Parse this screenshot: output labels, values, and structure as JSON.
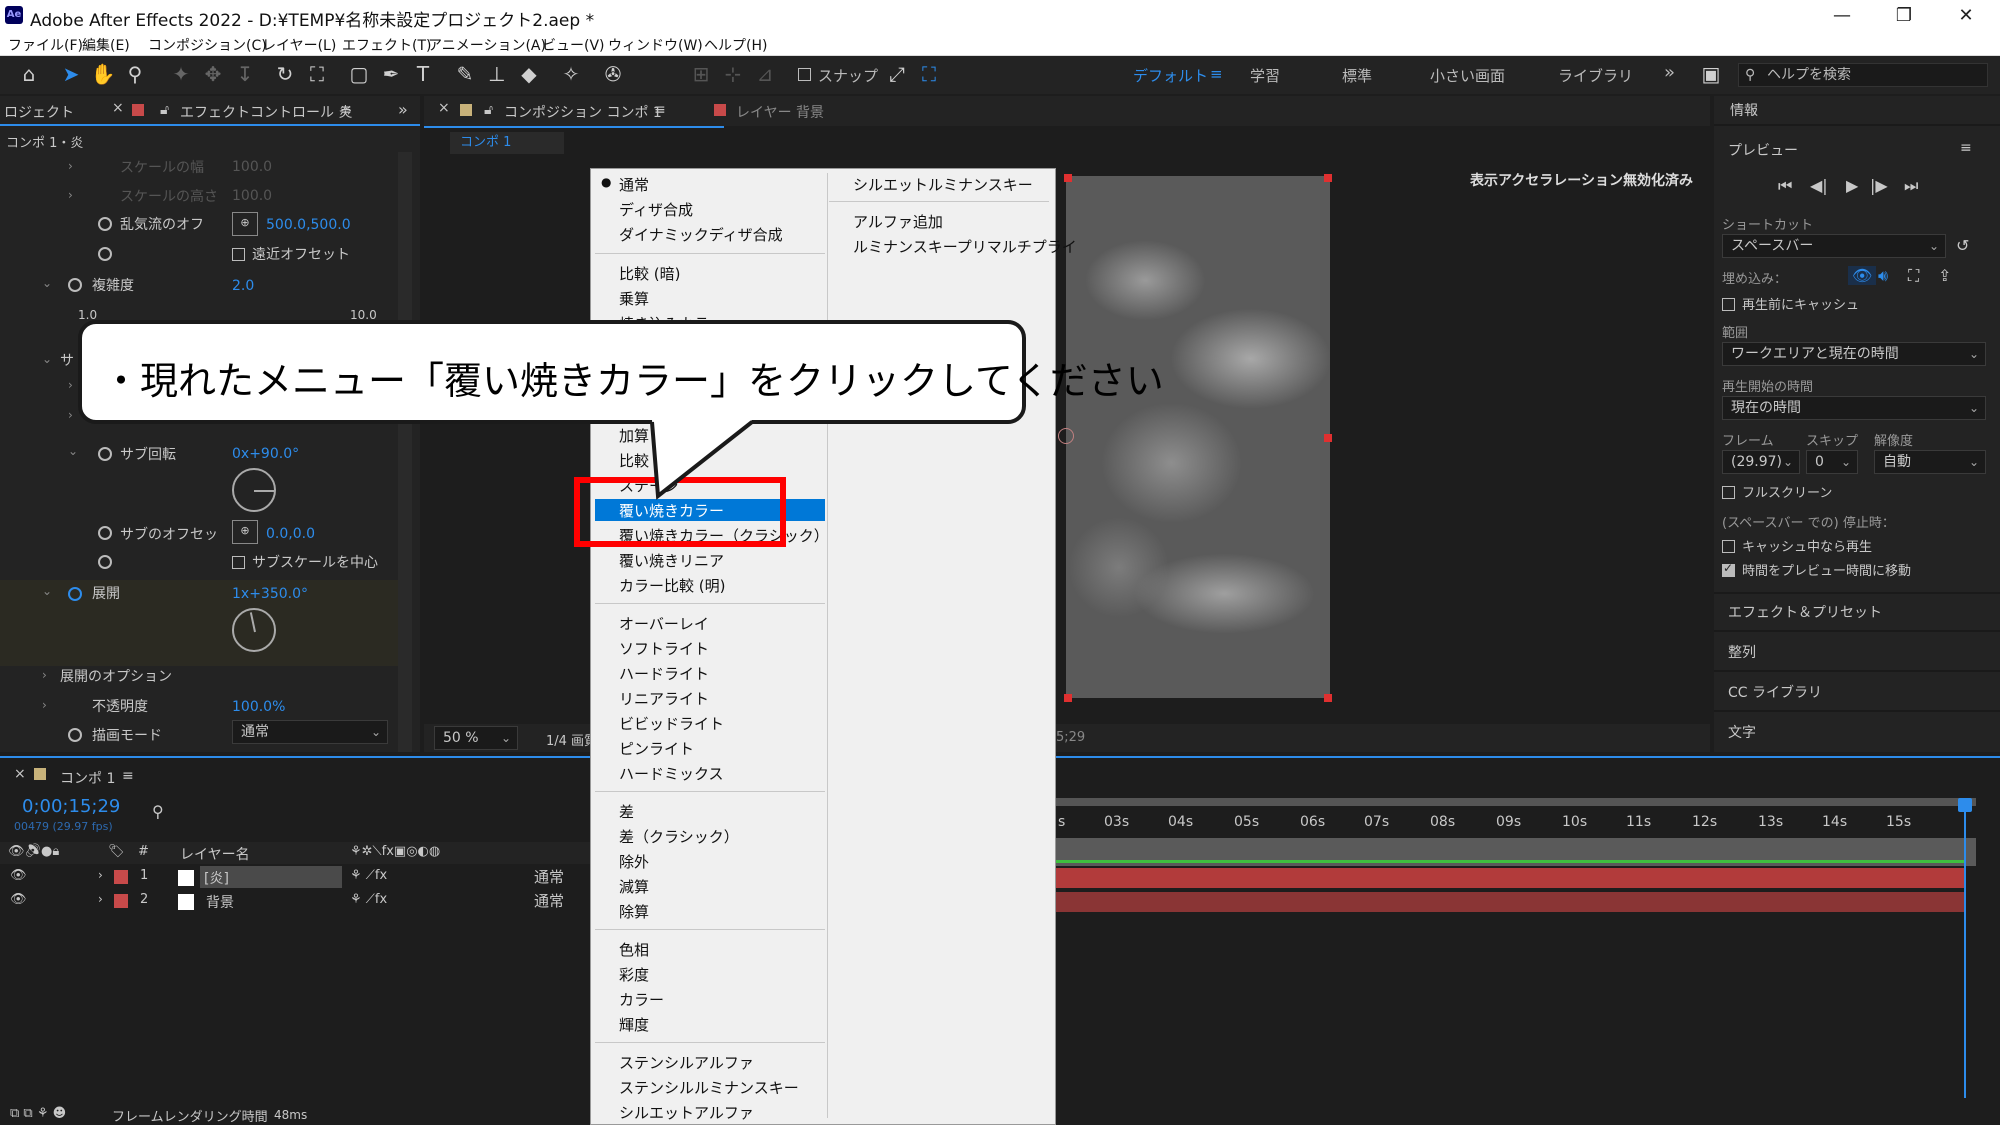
{
  "app": {
    "title": "Adobe After Effects 2022 - D:¥TEMP¥名称未設定プロジェクト2.aep *",
    "logo_text": "Ae",
    "window_controls": [
      "—",
      "❐",
      "✕"
    ]
  },
  "menubar": [
    "ファイル(F)",
    "編集(E)",
    "コンポジション(C)",
    "レイヤー(L)",
    "エフェクト(T)",
    "アニメーション(A)",
    "ビュー(V)",
    "ウィンドウ(W)",
    "ヘルプ(H)"
  ],
  "toolbar": {
    "snap_label": "スナップ",
    "workspaces": [
      "デフォルト",
      "学習",
      "標準",
      "小さい画面",
      "ライブラリ"
    ],
    "active_workspace": "デフォルト",
    "more": "»",
    "search_placeholder": "ヘルプを検索"
  },
  "left_panel": {
    "tab_project": "ロジェクト",
    "tab_effect_controls": "エフェクトコントロール 炎",
    "breadcrumb": "コンポ 1・炎",
    "props": [
      {
        "label": "スケールの幅",
        "value": "100.0"
      },
      {
        "label": "スケールの高さ",
        "value": "100.0"
      },
      {
        "label": "乱気流のオフ",
        "value": "500.0,500.0"
      },
      {
        "label": "遠近オフセット",
        "value": ""
      },
      {
        "label": "複雑度",
        "value": "2.0"
      },
      {
        "label": "1.0",
        "value": "10.0"
      },
      {
        "label": "サ",
        "value": ""
      },
      {
        "label": "サブ回転",
        "value": "0x+90.0°"
      },
      {
        "label": "サブのオフセッ",
        "value": "0.0,0.0"
      },
      {
        "label": "サブスケールを中心",
        "value": ""
      },
      {
        "label": "展開",
        "value": "1x+350.0°"
      },
      {
        "label": "展開のオプション",
        "value": ""
      },
      {
        "label": "不透明度",
        "value": "100.0%"
      },
      {
        "label": "描画モード",
        "value": "通常"
      }
    ]
  },
  "comp_panel": {
    "tab_composition": "コンポジション コンポ 1",
    "tab_layer": "レイヤー 背景",
    "comp_name": "コンポ 1",
    "acceleration_notice": "表示アクセラレーション無効化済み",
    "zoom": "50 %",
    "resolution": "1/4 画質",
    "timecode_fragment": "5;29"
  },
  "context_menu": {
    "col1_groups": [
      [
        "通常",
        "ディザ合成",
        "ダイナミックディザ合成"
      ],
      [
        "比較 (暗)",
        "乗算",
        "焼き込みカラー",
        "",
        "",
        "",
        "加算",
        "比較",
        "ステージ"
      ],
      [
        "覆い焼きカラー",
        "覆い焼きカラー（クラシック）",
        "覆い焼きリニア",
        "カラー比較 (明)"
      ],
      [
        "オーバーレイ",
        "ソフトライト",
        "ハードライト",
        "リニアライト",
        "ビビッドライト",
        "ピンライト",
        "ハードミックス"
      ],
      [
        "差",
        "差（クラシック）",
        "除外",
        "減算",
        "除算"
      ],
      [
        "色相",
        "彩度",
        "カラー",
        "輝度"
      ],
      [
        "ステンシルアルファ",
        "ステンシルルミナンスキー",
        "シルエットアルファ"
      ]
    ],
    "checked_item": "通常",
    "highlighted_item": "覆い焼きカラー",
    "col2_groups": [
      [
        "シルエットルミナンスキー"
      ],
      [
        "アルファ追加",
        "ルミナンスキープリマルチプライ"
      ]
    ]
  },
  "callout": {
    "text": "・現れたメニュー「覆い焼きカラー」をクリックしてください"
  },
  "right_panel": {
    "info": "情報",
    "preview": "プレビュー",
    "shortcut_label": "ショートカット",
    "shortcut_value": "スペースバー",
    "embed_label": "埋め込み：",
    "cache_before_play": "再生前にキャッシュ",
    "range_label": "範囲",
    "range_value": "ワークエリアと現在の時間",
    "play_from_label": "再生開始の時間",
    "play_from_value": "現在の時間",
    "frame_label": "フレーム",
    "skip_label": "スキップ",
    "res_label": "解像度",
    "frame_value": "(29.97)",
    "skip_value": "0",
    "res_value": "自動",
    "fullscreen": "フルスクリーン",
    "stop_label": "(スペースバー での) 停止時：",
    "play_if_cached": "キャッシュ中なら再生",
    "move_time": "時間をプレビュー時間に移動",
    "sections": [
      "エフェクト＆プリセット",
      "整列",
      "CC ライブラリ",
      "文字"
    ]
  },
  "timeline": {
    "tab": "コンポ 1",
    "timecode": "0;00;15;29",
    "frames": "00479 (29.97 fps)",
    "col_layer_name": "レイヤー名",
    "col_num": "#",
    "layers": [
      {
        "num": "1",
        "name": "[炎]",
        "mode": "通常"
      },
      {
        "num": "2",
        "name": "背景",
        "mode": "通常"
      }
    ],
    "ruler": [
      "s",
      "03s",
      "04s",
      "05s",
      "06s",
      "07s",
      "08s",
      "09s",
      "10s",
      "11s",
      "12s",
      "13s",
      "14s",
      "15s"
    ],
    "render_label": "フレームレンダリング時間",
    "render_value": "48ms"
  }
}
